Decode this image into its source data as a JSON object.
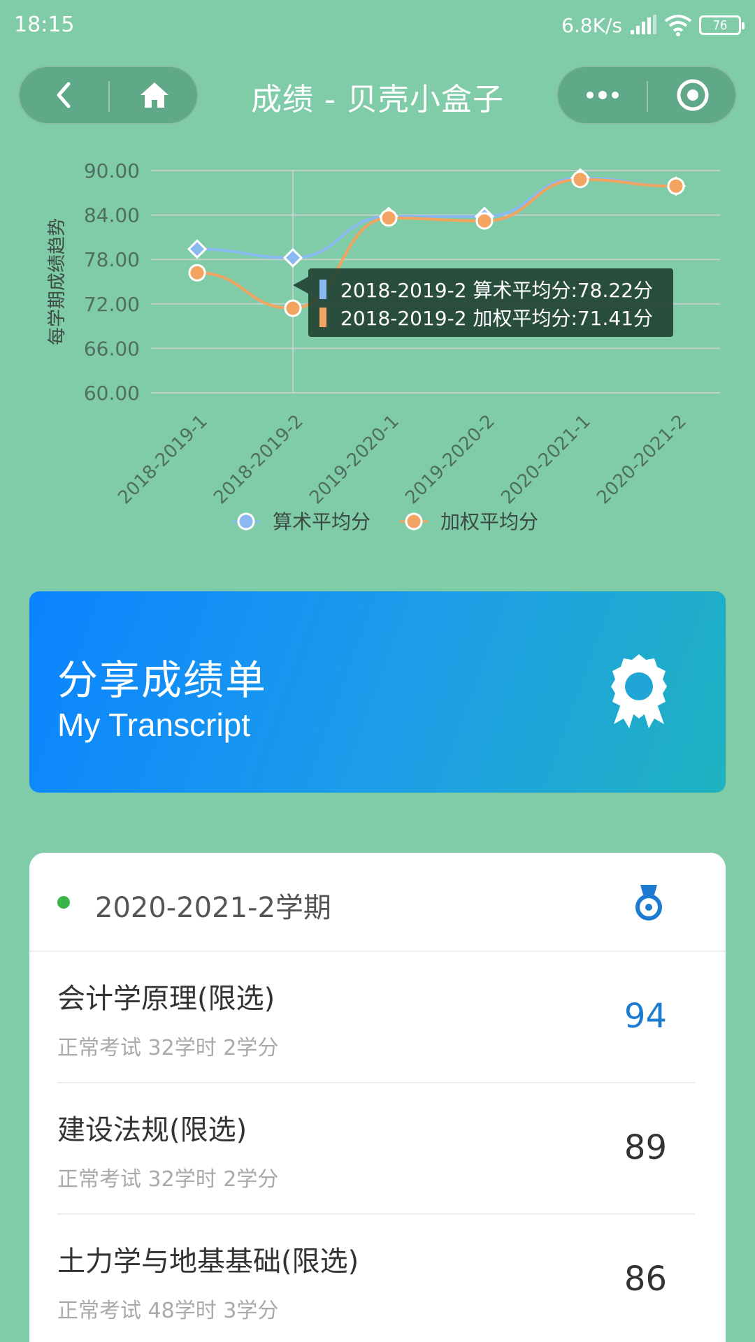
{
  "status_bar": {
    "time": "18:15",
    "network_speed": "6.8K/s",
    "battery": "76"
  },
  "nav": {
    "title": "成绩 - 贝壳小盒子"
  },
  "chart_data": {
    "type": "line",
    "title": "",
    "ylabel": "每学期成绩趋势",
    "xlabel": "",
    "ylim": [
      60,
      90
    ],
    "yticks": [
      "90.00",
      "84.00",
      "78.00",
      "72.00",
      "66.00",
      "60.00"
    ],
    "categories": [
      "2018-2019-1",
      "2018-2019-2",
      "2019-2020-1",
      "2019-2020-2",
      "2020-2021-1",
      "2020-2021-2"
    ],
    "series": [
      {
        "name": "算术平均分",
        "color": "#8ab8f0",
        "marker": "diamond",
        "values": [
          79.4,
          78.22,
          83.8,
          83.8,
          89.0,
          87.9
        ]
      },
      {
        "name": "加权平均分",
        "color": "#f3a460",
        "marker": "circle",
        "values": [
          76.2,
          71.41,
          83.6,
          83.2,
          88.8,
          87.9
        ]
      }
    ],
    "legend_position": "bottom",
    "grid": true,
    "tooltip": {
      "lines": [
        "2018-2019-2 算术平均分:78.22分",
        "2018-2019-2 加权平均分:71.41分"
      ]
    }
  },
  "share": {
    "title": "分享成绩单",
    "subtitle": "My Transcript",
    "icon": "award-icon"
  },
  "semester": {
    "title": "2020-2021-2学期",
    "icon": "medal-icon",
    "courses": [
      {
        "name": "会计学原理(限选)",
        "meta": "正常考试 32学时 2学分",
        "score": "94"
      },
      {
        "name": "建设法规(限选)",
        "meta": "正常考试 32学时 2学分",
        "score": "89"
      },
      {
        "name": "土力学与地基基础(限选)",
        "meta": "正常考试 48学时 3学分",
        "score": "86"
      }
    ]
  },
  "colors": {
    "background": "#80cca8",
    "accent_blue": "#1c7bd1",
    "dot_green": "#3ab44a"
  }
}
